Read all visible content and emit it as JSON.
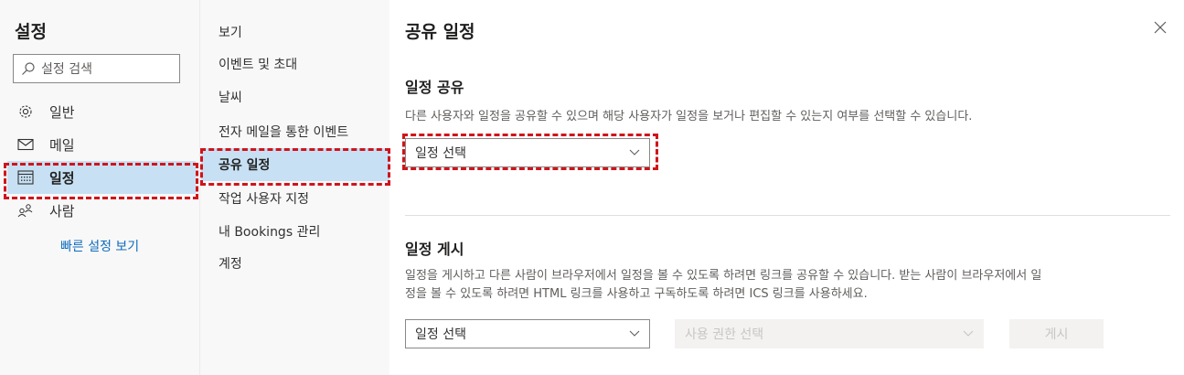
{
  "settings": {
    "title": "설정",
    "search_placeholder": "설정 검색",
    "nav": [
      {
        "label": "일반",
        "icon": "gear-icon"
      },
      {
        "label": "메일",
        "icon": "mail-icon"
      },
      {
        "label": "일정",
        "icon": "calendar-icon",
        "selected": true
      },
      {
        "label": "사람",
        "icon": "people-icon"
      }
    ],
    "quick_settings": "빠른 설정 보기"
  },
  "subnav": {
    "items": [
      {
        "label": "보기"
      },
      {
        "label": "이벤트 및 초대"
      },
      {
        "label": "날씨"
      },
      {
        "label": "전자 메일을 통한 이벤트"
      },
      {
        "label": "공유 일정",
        "selected": true
      },
      {
        "label": "작업 사용자 지정"
      },
      {
        "label": "내 Bookings 관리"
      },
      {
        "label": "계정"
      }
    ]
  },
  "panel": {
    "title": "공유 일정",
    "share": {
      "heading": "일정 공유",
      "description": "다른 사용자와 일정을 공유할 수 있으며 해당 사용자가 일정을 보거나 편집할 수 있는지 여부를 선택할 수 있습니다.",
      "select_placeholder": "일정 선택"
    },
    "publish": {
      "heading": "일정 게시",
      "description_line1": "일정을 게시하고 다른 사람이 브라우저에서 일정을 볼 수 있도록 하려면 링크를 공유할 수 있습니다. 받는 사람이 브라우저에서 일",
      "description_line2": "정을 볼 수 있도록 하려면 HTML 링크를 사용하고 구독하도록 하려면 ICS 링크를 사용하세요.",
      "calendar_select": "일정 선택",
      "permission_select": "사용 권한 선택",
      "publish_button": "게시"
    }
  },
  "colors": {
    "selected_bg": "#c7e0f4",
    "link": "#0f6cbd",
    "highlight_dash": "#d0141b"
  }
}
